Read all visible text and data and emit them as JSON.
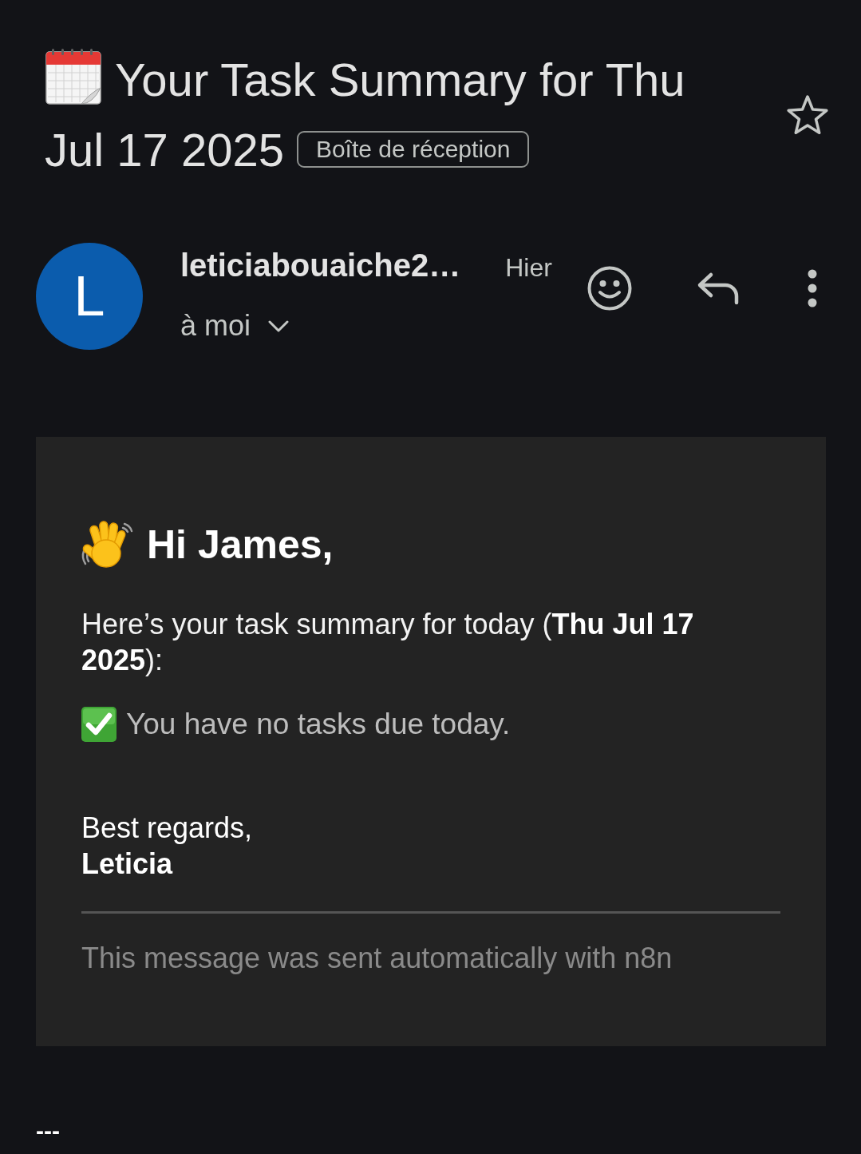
{
  "message": {
    "subject_lines": [
      "Your Task Summary for Thu",
      "Jul 17 2025"
    ],
    "label": "Boîte de réception",
    "starred": false
  },
  "sender": {
    "avatar_letter": "L",
    "name": "leticiabouaiche2…",
    "time": "Hier",
    "recipients": "à moi"
  },
  "body": {
    "greeting": "Hi James,",
    "intro": "Here’s your task summary for today (**Thu Jul 17 2025**):",
    "status": "You have no tasks due today.",
    "closing": "Best regards,",
    "signature": "Leticia",
    "footer": "This message was sent automatically with n8n"
  },
  "trailer": "---"
}
